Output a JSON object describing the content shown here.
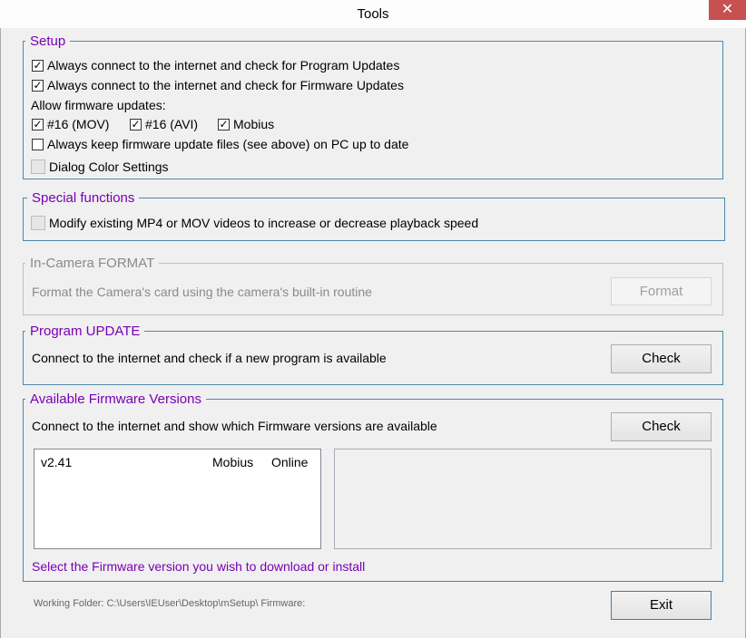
{
  "window": {
    "title": "Tools",
    "close_symbol": "✕"
  },
  "setup": {
    "legend": "Setup",
    "program_updates": {
      "label": "Always connect to the internet and check for Program Updates",
      "checked": true
    },
    "firmware_updates": {
      "label": "Always connect to the internet and check for Firmware Updates",
      "checked": true
    },
    "allow_label": "Allow firmware updates:",
    "mov": {
      "label": "#16 (MOV)",
      "checked": true
    },
    "avi": {
      "label": "#16 (AVI)",
      "checked": true
    },
    "mobius": {
      "label": "Mobius",
      "checked": true
    },
    "keep_files": {
      "label": "Always keep firmware update files (see above) on PC up to date",
      "checked": false
    },
    "dialog_color": {
      "label": "Dialog Color Settings",
      "checked": false
    }
  },
  "special": {
    "legend": "Special functions",
    "modify_videos": {
      "label": "Modify existing MP4 or MOV videos to increase or decrease playback speed",
      "checked": false
    }
  },
  "format": {
    "legend": "In-Camera FORMAT",
    "description": "Format the Camera's card using the camera's built-in routine",
    "button": "Format"
  },
  "program_update": {
    "legend": "Program UPDATE",
    "description": "Connect to the internet and check if a new program is available",
    "button": "Check"
  },
  "firmware": {
    "legend": "Available Firmware Versions",
    "description": "Connect to the internet and show which Firmware versions are available",
    "button": "Check",
    "list": [
      {
        "version": "v2.41",
        "model": "Mobius",
        "status": "Online"
      }
    ],
    "hint": "Select the Firmware version you wish to download or install"
  },
  "footer": {
    "working_folder": "Working Folder: C:\\Users\\IEUser\\Desktop\\mSetup\\  Firmware:",
    "exit_button": "Exit"
  },
  "colors": {
    "accent": "#7a00b4",
    "group_border": "#4d87a8",
    "close": "#c75050"
  }
}
